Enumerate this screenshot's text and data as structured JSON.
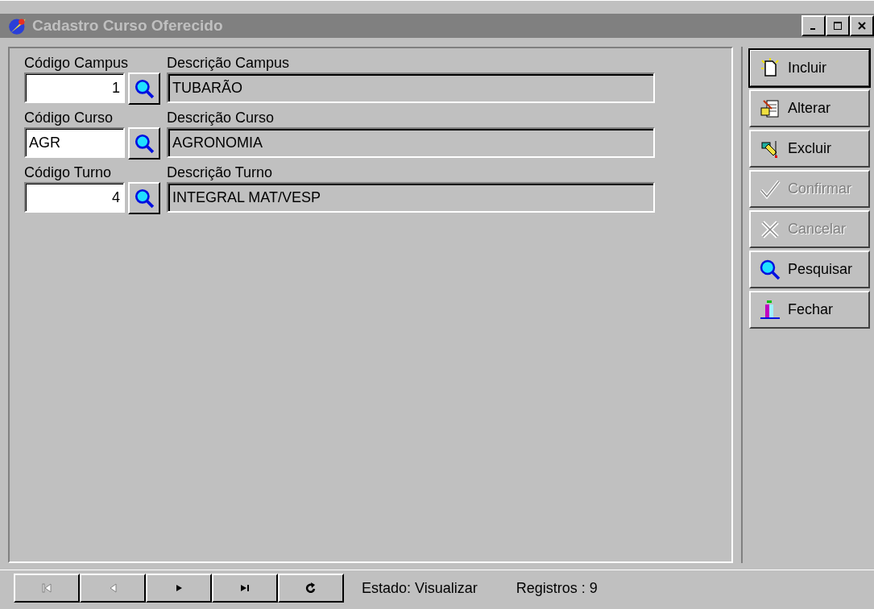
{
  "window": {
    "title": "Cadastro Curso Oferecido"
  },
  "fields": [
    {
      "code_label": "Código Campus",
      "code_value": "1",
      "kind": "numeric",
      "desc_label": "Descrição Campus",
      "desc_value": "TUBARÃO"
    },
    {
      "code_label": "Código Curso",
      "code_value": "AGR",
      "kind": "text",
      "desc_label": "Descrição Curso",
      "desc_value": "AGRONOMIA"
    },
    {
      "code_label": "Código Turno",
      "code_value": "4",
      "kind": "numeric",
      "desc_label": "Descrição Turno",
      "desc_value": "INTEGRAL MAT/VESP"
    }
  ],
  "actions": [
    {
      "kind": "new",
      "label": "Incluir",
      "disabled": false,
      "default": true
    },
    {
      "kind": "edit",
      "label": "Alterar",
      "disabled": false,
      "default": false
    },
    {
      "kind": "delete",
      "label": "Excluir",
      "disabled": false,
      "default": false
    },
    {
      "kind": "confirm",
      "label": "Confirmar",
      "disabled": true,
      "default": false
    },
    {
      "kind": "cancel",
      "label": "Cancelar",
      "disabled": true,
      "default": false
    },
    {
      "kind": "search",
      "label": "Pesquisar",
      "disabled": false,
      "default": false
    },
    {
      "kind": "close",
      "label": "Fechar",
      "disabled": false,
      "default": false
    }
  ],
  "navigator": [
    {
      "kind": "first",
      "disabled": true
    },
    {
      "kind": "prev",
      "disabled": true
    },
    {
      "kind": "next",
      "disabled": false
    },
    {
      "kind": "last",
      "disabled": false
    },
    {
      "kind": "refresh",
      "disabled": false
    }
  ],
  "status": {
    "state": "Estado: Visualizar",
    "records": "Registros : 9"
  }
}
